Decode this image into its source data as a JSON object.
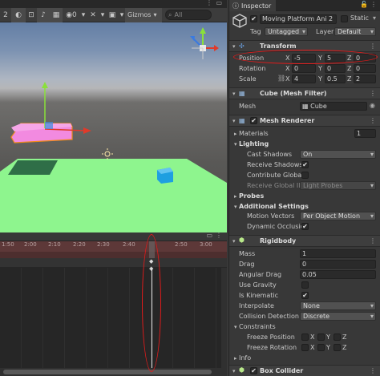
{
  "scene": {
    "toolbar": {
      "items": [
        "2",
        "◐",
        "⊡",
        "♪",
        "▦",
        "◉0",
        "▾",
        "✕",
        "▾",
        "▣",
        "▾"
      ],
      "gizmos_label": "Gizmos",
      "search_placeholder": "All"
    },
    "colors": {
      "ground": "#8ef58e",
      "platform": "#f28ae0",
      "cube": "#1e9fe0",
      "shadow": "#2f6e47"
    }
  },
  "timeline": {
    "ticks": [
      "1:50",
      "2:00",
      "2:10",
      "2:20",
      "2:30",
      "2:40",
      "2:50",
      "3:00"
    ]
  },
  "inspector": {
    "tab_label": "Inspector",
    "object_name": "Moving Platform Ani 2",
    "static_label": "Static",
    "tag_label": "Tag",
    "tag_value": "Untagged",
    "layer_label": "Layer",
    "layer_value": "Default",
    "transform": {
      "title": "Transform",
      "rows": [
        {
          "label": "Position",
          "x": "-5",
          "y": "5",
          "z": "0"
        },
        {
          "label": "Rotation",
          "x": "0",
          "y": "0",
          "z": "0"
        },
        {
          "label": "Scale",
          "x": "4",
          "y": "0.5",
          "z": "2"
        }
      ]
    },
    "mesh_filter": {
      "title": "Cube (Mesh Filter)",
      "mesh_label": "Mesh",
      "mesh_value": "Cube"
    },
    "mesh_renderer": {
      "title": "Mesh Renderer",
      "materials_label": "Materials",
      "materials_count": "1",
      "lighting_label": "Lighting",
      "cast_shadows_label": "Cast Shadows",
      "cast_shadows_value": "On",
      "receive_shadows_label": "Receive Shadows",
      "contribute_gi_label": "Contribute Global",
      "receive_gi_label": "Receive Global Illu",
      "receive_gi_value": "Light Probes",
      "probes_label": "Probes",
      "additional_label": "Additional Settings",
      "motion_vectors_label": "Motion Vectors",
      "motion_vectors_value": "Per Object Motion",
      "dynamic_occlusion_label": "Dynamic Occlusio"
    },
    "rigidbody": {
      "title": "Rigidbody",
      "mass_label": "Mass",
      "mass_value": "1",
      "drag_label": "Drag",
      "drag_value": "0",
      "angular_drag_label": "Angular Drag",
      "angular_drag_value": "0.05",
      "use_gravity_label": "Use Gravity",
      "is_kinematic_label": "Is Kinematic",
      "interpolate_label": "Interpolate",
      "interpolate_value": "None",
      "collision_label": "Collision Detection",
      "collision_value": "Discrete",
      "constraints_label": "Constraints",
      "freeze_position_label": "Freeze Position",
      "freeze_rotation_label": "Freeze Rotation",
      "x": "X",
      "y": "Y",
      "z": "Z",
      "info_label": "Info"
    },
    "box_collider": {
      "title": "Box Collider"
    },
    "checkmark": "✔"
  },
  "annotation_color": "#e01b1b"
}
